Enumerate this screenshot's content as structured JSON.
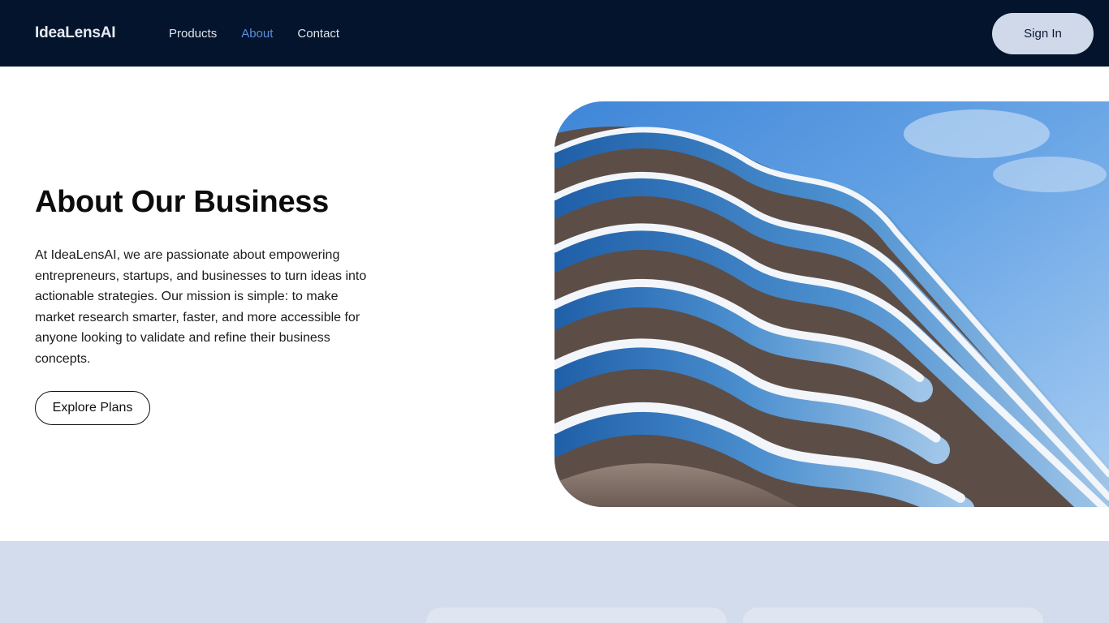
{
  "header": {
    "logo": "IdeaLensAI",
    "nav": [
      {
        "label": "Products",
        "active": false
      },
      {
        "label": "About",
        "active": true
      },
      {
        "label": "Contact",
        "active": false
      }
    ],
    "sign_in_label": "Sign In"
  },
  "hero": {
    "title": "About Our Business",
    "body": "At IdeaLensAI, we are passionate about empowering entrepreneurs, startups, and businesses to turn ideas into actionable strategies. Our mission is simple: to make market research smarter, faster, and more accessible for anyone looking to validate and refine their business concepts.",
    "cta_label": "Explore Plans"
  },
  "colors": {
    "header_bg": "#04142c",
    "nav_active": "#5b8fdd",
    "sign_in_bg": "#cfd9ea",
    "band_bg": "#d2dcec"
  }
}
